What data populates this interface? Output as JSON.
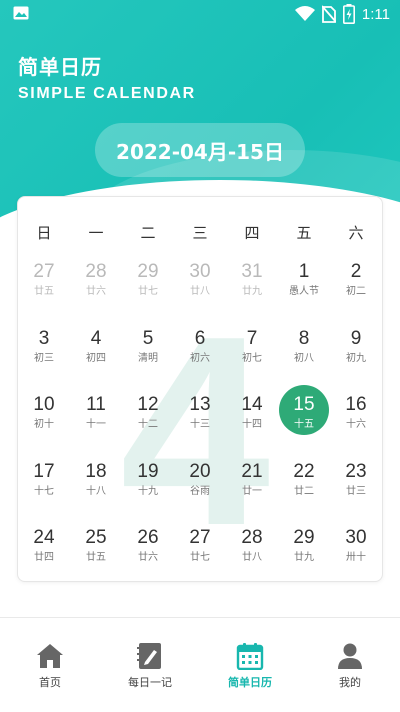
{
  "status": {
    "time": "1:11"
  },
  "header": {
    "title_cn": "简单日历",
    "title_en": "SIMPLE CALENDAR",
    "current_date": "2022-04月-15日"
  },
  "calendar": {
    "big_month": "4",
    "weekdays": [
      "日",
      "一",
      "二",
      "三",
      "四",
      "五",
      "六"
    ],
    "days": [
      {
        "num": "27",
        "lunar": "廿五",
        "other": true
      },
      {
        "num": "28",
        "lunar": "廿六",
        "other": true
      },
      {
        "num": "29",
        "lunar": "廿七",
        "other": true
      },
      {
        "num": "30",
        "lunar": "廿八",
        "other": true
      },
      {
        "num": "31",
        "lunar": "廿九",
        "other": true
      },
      {
        "num": "1",
        "lunar": "愚人节"
      },
      {
        "num": "2",
        "lunar": "初二"
      },
      {
        "num": "3",
        "lunar": "初三"
      },
      {
        "num": "4",
        "lunar": "初四"
      },
      {
        "num": "5",
        "lunar": "清明"
      },
      {
        "num": "6",
        "lunar": "初六"
      },
      {
        "num": "7",
        "lunar": "初七"
      },
      {
        "num": "8",
        "lunar": "初八"
      },
      {
        "num": "9",
        "lunar": "初九"
      },
      {
        "num": "10",
        "lunar": "初十"
      },
      {
        "num": "11",
        "lunar": "十一"
      },
      {
        "num": "12",
        "lunar": "十二"
      },
      {
        "num": "13",
        "lunar": "十三"
      },
      {
        "num": "14",
        "lunar": "十四"
      },
      {
        "num": "15",
        "lunar": "十五",
        "selected": true
      },
      {
        "num": "16",
        "lunar": "十六"
      },
      {
        "num": "17",
        "lunar": "十七"
      },
      {
        "num": "18",
        "lunar": "十八"
      },
      {
        "num": "19",
        "lunar": "十九"
      },
      {
        "num": "20",
        "lunar": "谷雨"
      },
      {
        "num": "21",
        "lunar": "廿一"
      },
      {
        "num": "22",
        "lunar": "廿二"
      },
      {
        "num": "23",
        "lunar": "廿三"
      },
      {
        "num": "24",
        "lunar": "廿四"
      },
      {
        "num": "25",
        "lunar": "廿五"
      },
      {
        "num": "26",
        "lunar": "廿六"
      },
      {
        "num": "27",
        "lunar": "廿七"
      },
      {
        "num": "28",
        "lunar": "廿八"
      },
      {
        "num": "29",
        "lunar": "廿九"
      },
      {
        "num": "30",
        "lunar": "卅十"
      }
    ]
  },
  "nav": {
    "items": [
      {
        "label": "首页",
        "icon": "home-icon"
      },
      {
        "label": "每日一记",
        "icon": "notebook-pen-icon"
      },
      {
        "label": "简单日历",
        "icon": "calendar-icon",
        "active": true
      },
      {
        "label": "我的",
        "icon": "user-icon"
      }
    ]
  },
  "colors": {
    "accent": "#1cc2b8",
    "selected": "#2eaa77"
  }
}
